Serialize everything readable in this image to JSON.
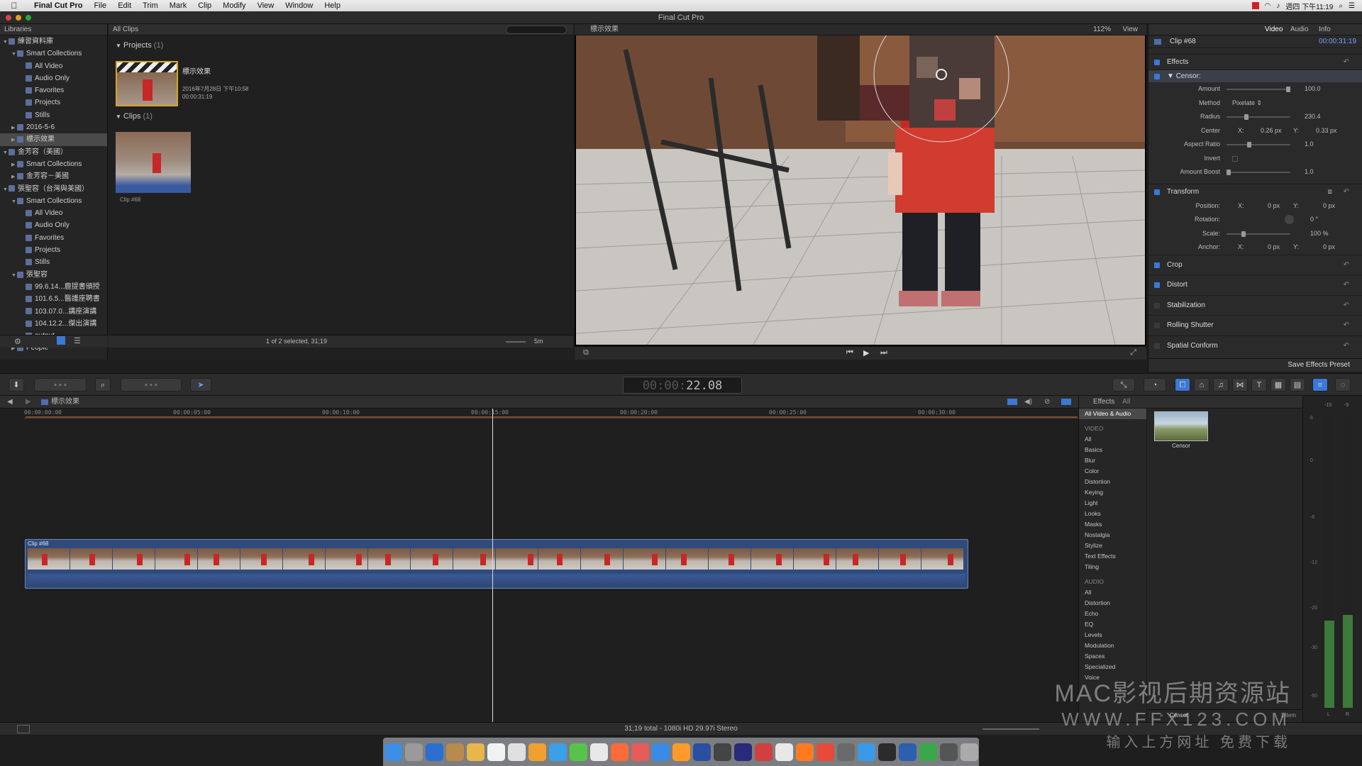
{
  "menubar": {
    "app": "Final Cut Pro",
    "items": [
      "File",
      "Edit",
      "Trim",
      "Mark",
      "Clip",
      "Modify",
      "View",
      "Window",
      "Help"
    ],
    "clock": "週四 下午11:19"
  },
  "window": {
    "title": "Final Cut Pro"
  },
  "libraries": {
    "header": "Libraries",
    "items": [
      {
        "label": "練習資料庫",
        "level": 0,
        "expanded": true
      },
      {
        "label": "Smart Collections",
        "level": 1,
        "expanded": true
      },
      {
        "label": "All Video",
        "level": 2
      },
      {
        "label": "Audio Only",
        "level": 2
      },
      {
        "label": "Favorites",
        "level": 2
      },
      {
        "label": "Projects",
        "level": 2
      },
      {
        "label": "Stills",
        "level": 2
      },
      {
        "label": "2016-5-6",
        "level": 1
      },
      {
        "label": "標示效果",
        "level": 1,
        "selected": true
      },
      {
        "label": "金芳容（美國）",
        "level": 0,
        "expanded": true
      },
      {
        "label": "Smart Collections",
        "level": 1
      },
      {
        "label": "金芳容－美國",
        "level": 1
      },
      {
        "label": "張聖容（台灣與美國）",
        "level": 0,
        "expanded": true
      },
      {
        "label": "Smart Collections",
        "level": 1,
        "expanded": true
      },
      {
        "label": "All Video",
        "level": 2
      },
      {
        "label": "Audio Only",
        "level": 2
      },
      {
        "label": "Favorites",
        "level": 2
      },
      {
        "label": "Projects",
        "level": 2
      },
      {
        "label": "Stills",
        "level": 2
      },
      {
        "label": "張聖容",
        "level": 1,
        "expanded": true
      },
      {
        "label": "99.6.14...鹿提書頒授",
        "level": 2
      },
      {
        "label": "101.6.5...醫護座聘書",
        "level": 2
      },
      {
        "label": "103.07.0...講座演講",
        "level": 2
      },
      {
        "label": "104.12.2...傑出演講",
        "level": 2
      },
      {
        "label": "output",
        "level": 2
      },
      {
        "label": "People",
        "level": 1
      }
    ]
  },
  "browser": {
    "filter": "All Clips",
    "projects_label": "Projects",
    "projects_count": "(1)",
    "project_name": "標示效果",
    "project_date": "2016年7月28日 下午10:58",
    "project_duration": "00:00:31:19",
    "clips_label": "Clips",
    "clips_count": "(1)",
    "clip_name": "Clip #68",
    "status": "1 of 2 selected, 31;19",
    "zoom": "5m"
  },
  "viewer": {
    "title": "標示效果",
    "zoom": "112%",
    "view_label": "View"
  },
  "inspector": {
    "tabs": [
      "Video",
      "Audio",
      "Info"
    ],
    "clip_name": "Clip #68",
    "clip_tc": "00:00:31:19",
    "effects_label": "Effects",
    "censor_label": "Censor",
    "params": [
      {
        "label": "Amount",
        "value": "100.0",
        "level": 1.0
      },
      {
        "label": "Method",
        "value": "Pixelate"
      },
      {
        "label": "Radius",
        "value": "230.4",
        "level": 0.3
      },
      {
        "label": "Center",
        "x": "0.26 px",
        "y": "0.33 px"
      },
      {
        "label": "Aspect Ratio",
        "value": "1.0",
        "level": 0.35
      },
      {
        "label": "Invert",
        "value": ""
      },
      {
        "label": "Amount Boost",
        "value": "1.0",
        "level": 0.0
      }
    ],
    "transform_label": "Transform",
    "transform": [
      {
        "label": "Position:",
        "x": "0 px",
        "y": "0 px"
      },
      {
        "label": "Rotation:",
        "value": "0 °"
      },
      {
        "label": "Scale:",
        "value": "100 %",
        "level": 0.25
      },
      {
        "label": "Anchor:",
        "x": "0 px",
        "y": "0 px"
      }
    ],
    "sections": [
      "Crop",
      "Distort",
      "Stabilization",
      "Rolling Shutter",
      "Spatial Conform"
    ],
    "save_preset": "Save Effects Preset"
  },
  "toolbar": {
    "timecode": "22.08"
  },
  "timeline": {
    "project": "標示效果",
    "ruler": [
      "00:00:00:00",
      "00:00:05:00",
      "00:00:10:00",
      "00:00:15:00",
      "00:00:20:00",
      "00:00:25:00",
      "00:00:30:00"
    ],
    "clip_label": "Clip #68",
    "playhead_fraction": 0.51
  },
  "effects": {
    "header": "Effects",
    "all": "All",
    "selected_category": "All Video & Audio",
    "video_head": "VIDEO",
    "video": [
      "All",
      "Basics",
      "Blur",
      "Color",
      "Distortion",
      "Keying",
      "Light",
      "Looks",
      "Masks",
      "Nostalgia",
      "Stylize",
      "Text Effects",
      "Tiling"
    ],
    "audio_head": "AUDIO",
    "audio": [
      "All",
      "Distortion",
      "Echo",
      "EQ",
      "Levels",
      "Modulation",
      "Spaces",
      "Specialized",
      "Voice"
    ],
    "thumb_label": "Censor",
    "search_value": "Censor",
    "count": "1 item"
  },
  "meters": {
    "ticks": [
      "6",
      "0",
      "-6",
      "-12",
      "-20",
      "-30",
      "-50"
    ],
    "channels": [
      "L",
      "R"
    ],
    "top": [
      "-15",
      "-9"
    ]
  },
  "status": "31;19 total - 1080i HD 29.97i Stereo",
  "watermark": {
    "line1": "MAC影视后期资源站",
    "line2": "WWW.FFX123.COM",
    "line3": "输入上方网址  免费下载"
  },
  "colors": {
    "accent": "#3b78d8",
    "clip": "#2f4b7c"
  }
}
